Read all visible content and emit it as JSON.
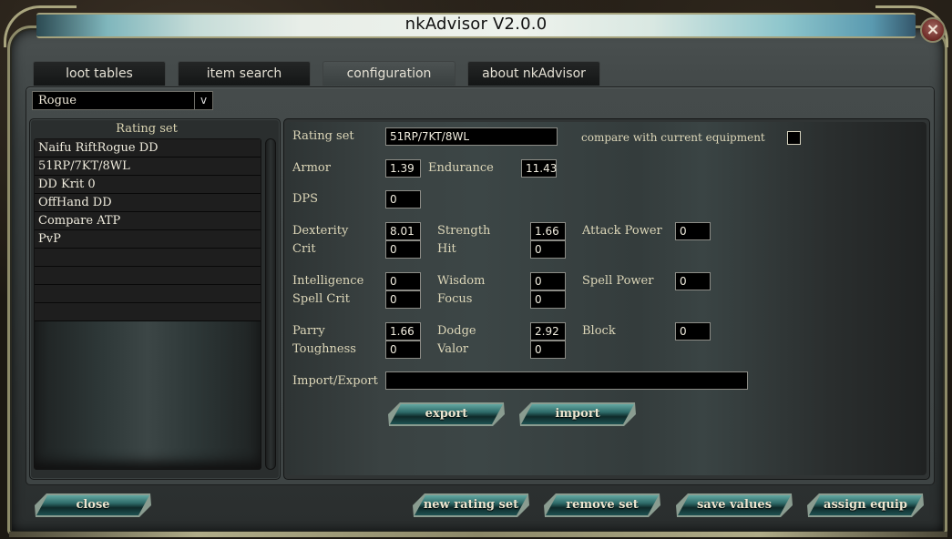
{
  "window": {
    "title": "nkAdvisor V2.0.0",
    "close_icon": "close-x-icon"
  },
  "tabs": [
    {
      "label": "loot tables",
      "active": false
    },
    {
      "label": "item search",
      "active": false
    },
    {
      "label": "configuration",
      "active": true
    },
    {
      "label": "about nkAdvisor",
      "active": false
    }
  ],
  "class_select": {
    "value": "Rogue",
    "arrow": "v"
  },
  "rating_sets": {
    "header": "Rating set",
    "items": [
      "Naifu RiftRogue DD",
      "51RP/7KT/8WL",
      "DD Krit 0",
      "OffHand DD",
      "Compare ATP",
      "PvP",
      "",
      "",
      "",
      ""
    ]
  },
  "config": {
    "rating_set_label": "Rating set",
    "rating_set_value": "51RP/7KT/8WL",
    "compare_label": "compare with current equipment",
    "compare_checked": false,
    "stats": {
      "armor": {
        "label": "Armor",
        "value": "1.39"
      },
      "endurance": {
        "label": "Endurance",
        "value": "11.43"
      },
      "dps": {
        "label": "DPS",
        "value": "0"
      },
      "dexterity": {
        "label": "Dexterity",
        "value": "8.01"
      },
      "strength": {
        "label": "Strength",
        "value": "1.66"
      },
      "attack_power": {
        "label": "Attack Power",
        "value": "0"
      },
      "crit": {
        "label": "Crit",
        "value": "0"
      },
      "hit": {
        "label": "Hit",
        "value": "0"
      },
      "intelligence": {
        "label": "Intelligence",
        "value": "0"
      },
      "wisdom": {
        "label": "Wisdom",
        "value": "0"
      },
      "spell_power": {
        "label": "Spell Power",
        "value": "0"
      },
      "spell_crit": {
        "label": "Spell Crit",
        "value": "0"
      },
      "focus": {
        "label": "Focus",
        "value": "0"
      },
      "parry": {
        "label": "Parry",
        "value": "1.66"
      },
      "dodge": {
        "label": "Dodge",
        "value": "2.92"
      },
      "block": {
        "label": "Block",
        "value": "0"
      },
      "toughness": {
        "label": "Toughness",
        "value": "0"
      },
      "valor": {
        "label": "Valor",
        "value": "0"
      }
    },
    "import_export_label": "Import/Export",
    "import_export_value": "",
    "export_button": "export",
    "import_button": "import"
  },
  "footer": {
    "close_button": "close",
    "new_rating_set_button": "new rating set",
    "remove_set_button": "remove set",
    "save_values_button": "save values",
    "assign_equip_button": "assign equip"
  }
}
